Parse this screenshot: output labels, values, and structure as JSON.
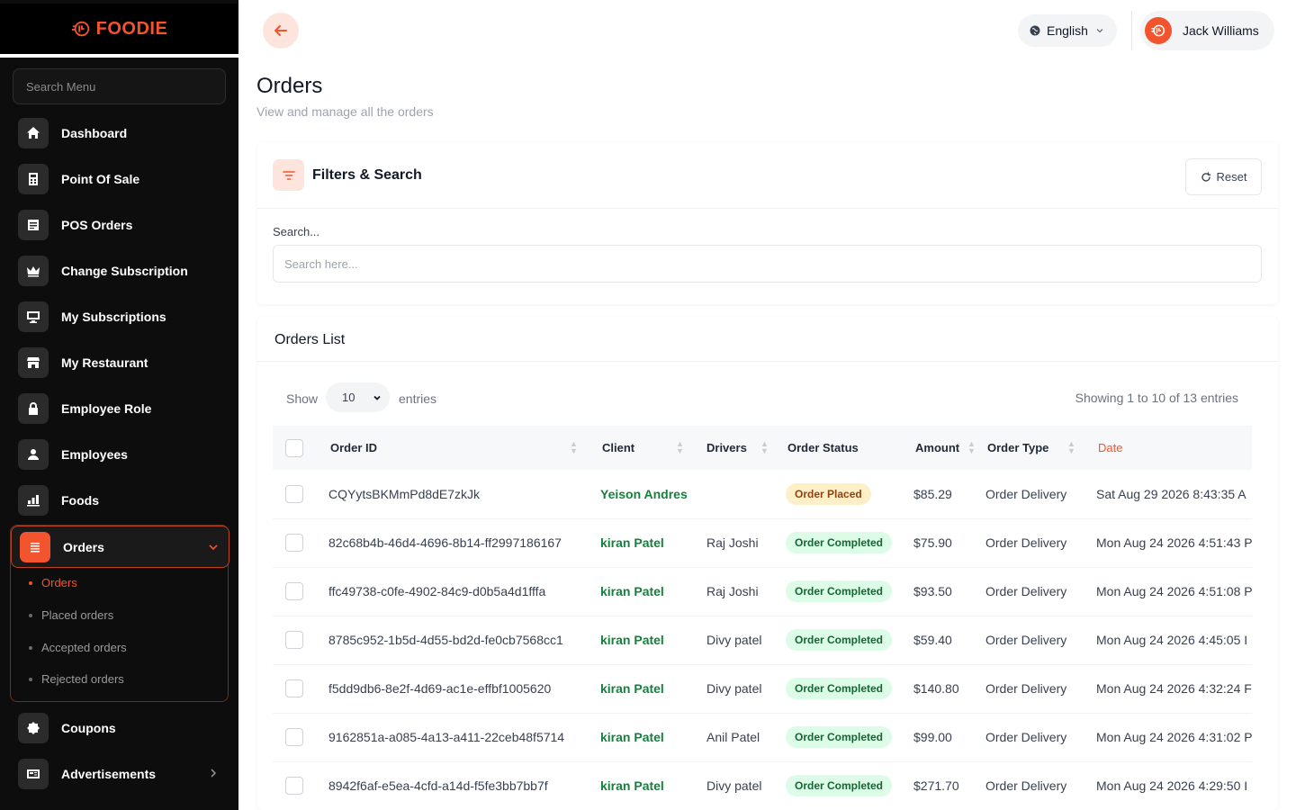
{
  "brand": {
    "name": "FOODIE",
    "accent": "#f2542d"
  },
  "sidebar": {
    "search_placeholder": "Search Menu",
    "items": [
      {
        "label": "Dashboard",
        "icon": "home-icon"
      },
      {
        "label": "Point Of Sale",
        "icon": "calculator-icon"
      },
      {
        "label": "POS Orders",
        "icon": "document-icon"
      },
      {
        "label": "Change Subscription",
        "icon": "crown-icon"
      },
      {
        "label": "My Subscriptions",
        "icon": "monitor-icon"
      },
      {
        "label": "My Restaurant",
        "icon": "store-icon"
      },
      {
        "label": "Employee Role",
        "icon": "lock-icon"
      },
      {
        "label": "Employees",
        "icon": "user-icon"
      },
      {
        "label": "Foods",
        "icon": "chart-icon"
      }
    ],
    "orders_group": {
      "label": "Orders",
      "sub_items": [
        "Orders",
        "Placed orders",
        "Accepted orders",
        "Rejected orders"
      ]
    },
    "bottom_items": [
      {
        "label": "Coupons",
        "icon": "badge-icon"
      },
      {
        "label": "Advertisements",
        "icon": "ad-icon"
      }
    ]
  },
  "header": {
    "language": "English",
    "user_name": "Jack Williams"
  },
  "page": {
    "title": "Orders",
    "subtitle": "View and manage all the orders"
  },
  "filters": {
    "title": "Filters & Search",
    "reset_label": "Reset",
    "search_label": "Search...",
    "search_placeholder": "Search here..."
  },
  "orders_list": {
    "title": "Orders List",
    "show_label": "Show",
    "entries_value": "10",
    "entries_label": "entries",
    "showing_info": "Showing 1 to 10 of 13 entries",
    "columns": [
      "Order ID",
      "Client",
      "Drivers",
      "Order Status",
      "Amount",
      "Order Type",
      "Date"
    ],
    "rows": [
      {
        "id": "CQYytsBKMmPd8dE7zkJk",
        "client": "Yeison Andres",
        "driver": "",
        "status": "Order Placed",
        "amount": "$85.29",
        "type": "Order Delivery",
        "date": "Sat Aug 29 2026 8:43:35 A"
      },
      {
        "id": "82c68b4b-46d4-4696-8b14-ff2997186167",
        "client": "kiran Patel",
        "driver": "Raj Joshi",
        "status": "Order Completed",
        "amount": "$75.90",
        "type": "Order Delivery",
        "date": "Mon Aug 24 2026 4:51:43 P"
      },
      {
        "id": "ffc49738-c0fe-4902-84c9-d0b5a4d1fffa",
        "client": "kiran Patel",
        "driver": "Raj Joshi",
        "status": "Order Completed",
        "amount": "$93.50",
        "type": "Order Delivery",
        "date": "Mon Aug 24 2026 4:51:08 P"
      },
      {
        "id": "8785c952-1b5d-4d55-bd2d-fe0cb7568cc1",
        "client": "kiran Patel",
        "driver": "Divy patel",
        "status": "Order Completed",
        "amount": "$59.40",
        "type": "Order Delivery",
        "date": "Mon Aug 24 2026 4:45:05 I"
      },
      {
        "id": "f5dd9db6-8e2f-4d69-ac1e-effbf1005620",
        "client": "kiran Patel",
        "driver": "Divy patel",
        "status": "Order Completed",
        "amount": "$140.80",
        "type": "Order Delivery",
        "date": "Mon Aug 24 2026 4:32:24 F"
      },
      {
        "id": "9162851a-a085-4a13-a411-22ceb48f5714",
        "client": "kiran Patel",
        "driver": "Anil Patel",
        "status": "Order Completed",
        "amount": "$99.00",
        "type": "Order Delivery",
        "date": "Mon Aug 24 2026 4:31:02 P"
      },
      {
        "id": "8942f6af-e5ea-4cfd-a14d-f5fe3bb7bb7f",
        "client": "kiran Patel",
        "driver": "Divy patel",
        "status": "Order Completed",
        "amount": "$271.70",
        "type": "Order Delivery",
        "date": "Mon Aug 24 2026 4:29:50 I"
      }
    ]
  }
}
